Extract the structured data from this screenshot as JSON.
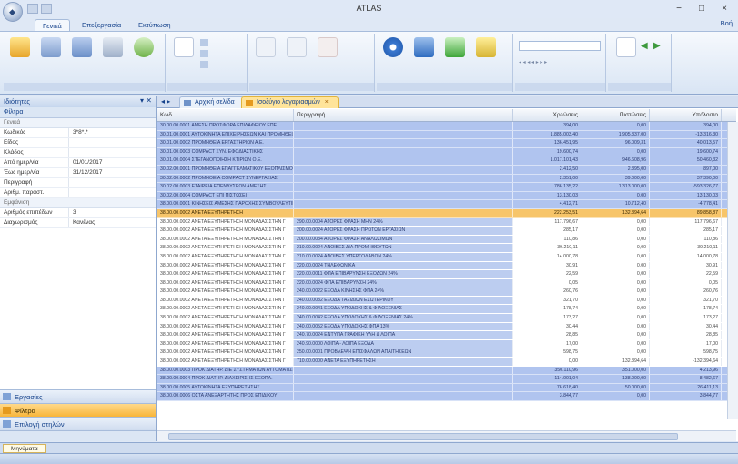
{
  "window": {
    "title": "ATLAS",
    "minimize": "−",
    "maximize": "□",
    "close": "×"
  },
  "ribbon_tabs": [
    "Γενικά",
    "Επεξεργασία",
    "Εκτύπωση"
  ],
  "ribbon_help": "Βοή",
  "left_panel": {
    "title": "Ιδιότητες",
    "subtitle": "Φίλτρα",
    "groups": [
      {
        "label": "Γενικά",
        "rows": [
          {
            "key": "Κωδικός",
            "value": "3*8*.*"
          },
          {
            "key": "Είδος",
            "value": ""
          },
          {
            "key": "Κλάδος",
            "value": ""
          },
          {
            "key": "Από ημερ/νία",
            "value": "01/01/2017"
          },
          {
            "key": "Έως ημερ/νία",
            "value": "31/12/2017"
          },
          {
            "key": "Περιγραφή",
            "value": ""
          },
          {
            "key": "Αριθμ. παραστ.",
            "value": ""
          }
        ]
      },
      {
        "label": "Εμφάνιση",
        "rows": [
          {
            "key": "Αριθμός επιπέδων",
            "value": "3"
          },
          {
            "key": "Διαχωρισμός",
            "value": "Κανένας"
          }
        ]
      }
    ],
    "nav": [
      {
        "label": "Εργασίες",
        "active": false
      },
      {
        "label": "Φίλτρα",
        "active": true
      },
      {
        "label": "Επιλογή στηλών",
        "active": false
      }
    ]
  },
  "doc_tabs": [
    {
      "label": "Αρχική σελίδα",
      "active": false
    },
    {
      "label": "Ισοζύγιο λογαριασμών",
      "active": true
    }
  ],
  "grid": {
    "columns": [
      "Κωδ.",
      "Περιγραφή",
      "Χρεώσεις",
      "Πιστώσεις",
      "Υπόλοιπο"
    ],
    "rows": [
      {
        "t": "blue",
        "code": "30.00.00.0001 ΑΜΕΣΗ ΠΡΟΣΦΟΡΑ ΕΠΙΔΑΦΕΙΟΥ ΕΠΕ",
        "desc": "",
        "a": "394,00",
        "b": "0,00",
        "c": "394,00"
      },
      {
        "t": "blue",
        "code": "30.01.00.0001 ΑΥΤΟΚΙΝΗΤΑ ΕΠΙΧΕΙΡΗΣΕΩΝ ΚΑΙ ΠΡΟΜΗΘΕΙΑ",
        "desc": "",
        "a": "1.885.003,40",
        "b": "1.905.337,00",
        "c": "-13.316,30"
      },
      {
        "t": "blue",
        "code": "30.01.00.0002 ΠΡΟΜΗΘΕΙΑ ΕΡΓΑΣΤΗΡΙΩΝ Α.Ε.",
        "desc": "",
        "a": "136.451,95",
        "b": "96.009,31",
        "c": "40.013,57"
      },
      {
        "t": "blue",
        "code": "30.01.00.0003 COMPACT ΣΥΝ. ΕΦΟΔΙΑΣΤΙΚΗΣ",
        "desc": "",
        "a": "19.600,74",
        "b": "0,00",
        "c": "19.600,74"
      },
      {
        "t": "blue",
        "code": "30.01.00.0004 ΣΤΕΓΑΝΟΠΟΙΗΣΗ ΚΤΙΡΙΩΝ Ο.Ε.",
        "desc": "",
        "a": "1.017.101,43",
        "b": "946.608,96",
        "c": "50.460,32"
      },
      {
        "t": "blue",
        "code": "30.02.00.0001 ΠΡΟΜΗΘΕΙΑ ΕΠΑΓΓΕΛΜΑΤΙΚΟΥ ΕΞΟΠΛΙΣΜΟΥ",
        "desc": "",
        "a": "2.412,50",
        "b": "2.395,00",
        "c": "897,00"
      },
      {
        "t": "blue",
        "code": "30.02.00.0002 ΠΡΟΜΗΘΕΙΑ COMPACT ΣΥΝΕΡΓΑΣΙΑΣ",
        "desc": "",
        "a": "2.351,00",
        "b": "39.000,00",
        "c": "37.390,00"
      },
      {
        "t": "blue",
        "code": "30.02.00.0003 ΕΤΑΙΡΕΙΑ ΕΠΕΝΔΥΣΕΩΝ ΑΜΕΣΗΣ",
        "desc": "",
        "a": "786.135,22",
        "b": "1.313.000,00",
        "c": "-593.326,77"
      },
      {
        "t": "blue",
        "code": "30.02.00.0004 COMPACT ΕΠΙ ΠΙΣΤΩΣΕΙ",
        "desc": "",
        "a": "13.130,03",
        "b": "0,00",
        "c": "13.130,03"
      },
      {
        "t": "blue",
        "code": "38.00.00.0001 ΚΙΝΗΣΕΙΣ ΑΜΕΣΗΣ ΠΑΡΟΧΗΣ ΣΥΜΒΟΥΛΕΥΤΙΚΗΣ",
        "desc": "",
        "a": "4.412,71",
        "b": "10.712,40",
        "c": "-4.778,41"
      },
      {
        "t": "selected",
        "code": "38.00.00.0002 ΑΝΕΤΑ ΕΞΥΠΗΡΕΤΗΣΗ",
        "desc": "",
        "a": "222.253,51",
        "b": "132.394,64",
        "c": "89.858,87"
      },
      {
        "t": "child",
        "code": "38.00.00.0002 ΑΝΕΤΑ ΕΞΥΠΗΡΕΤΗΣΗ ΜΟΝΑΔΑΣ ΣΤΗΝ Γ",
        "desc": "290.00.0004 ΑΓΟΡΕΣ ΦΡΑΣΗ ΜΗΝ 24%",
        "a": "117.796,67",
        "b": "0,00",
        "c": "117.796,67"
      },
      {
        "t": "child",
        "code": "38.00.00.0002 ΑΝΕΤΑ ΕΞΥΠΗΡΕΤΗΣΗ ΜΟΝΑΔΑΣ ΣΤΗΝ Γ",
        "desc": "200.00.0024 ΑΓΟΡΕΣ ΦΡΑΣΗ ΠΡΩΤΩΝ ΕΡΓΑΣΙΩΝ",
        "a": "285,17",
        "b": "0,00",
        "c": "285,17"
      },
      {
        "t": "child",
        "code": "38.00.00.0002 ΑΝΕΤΑ ΕΞΥΠΗΡΕΤΗΣΗ ΜΟΝΑΔΑΣ ΣΤΗΝ Γ",
        "desc": "200.00.0034 ΑΓΟΡΕΣ ΦΡΑΣΗ ΑΝΑΛΩΣΙΜΩΝ",
        "a": "110,86",
        "b": "0,00",
        "c": "110,86"
      },
      {
        "t": "child",
        "code": "38.00.00.0002 ΑΝΕΤΑ ΕΞΥΠΗΡΕΤΗΣΗ ΜΟΝΑΔΑΣ ΣΤΗΝ Γ",
        "desc": "210.00.0024 ΑΝΟΙΒΕΣ ΔΙΑ ΠΡΟΜΗΘΕΥΤΩΝ",
        "a": "39.210,11",
        "b": "0,00",
        "c": "39.210,11"
      },
      {
        "t": "child",
        "code": "38.00.00.0002 ΑΝΕΤΑ ΕΞΥΠΗΡΕΤΗΣΗ ΜΟΝΑΔΑΣ ΣΤΗΝ Γ",
        "desc": "210.00.0024 ΑΝΟΙΒΕΣ ΥΠΕΡΓΟΛΑΒΩΝ 24%",
        "a": "14.000,78",
        "b": "0,00",
        "c": "14.000,78"
      },
      {
        "t": "child",
        "code": "38.00.00.0002 ΑΝΕΤΑ ΕΞΥΠΗΡΕΤΗΣΗ ΜΟΝΑΔΑΣ ΣΤΗΝ Γ",
        "desc": "220.00.0024 ΤΗΛΕΦΩΝΙΚΑ",
        "a": "30,91",
        "b": "0,00",
        "c": "30,91"
      },
      {
        "t": "child",
        "code": "38.00.00.0002 ΑΝΕΤΑ ΕΞΥΠΗΡΕΤΗΣΗ ΜΟΝΑΔΑΣ ΣΤΗΝ Γ",
        "desc": "220.00.0011 ΦΠΑ ΕΠΙΒΑΡΥΝΣΗ ΕΞΟΔΩΝ 24%",
        "a": "22,59",
        "b": "0,00",
        "c": "22,59"
      },
      {
        "t": "child",
        "code": "38.00.00.0002 ΑΝΕΤΑ ΕΞΥΠΗΡΕΤΗΣΗ ΜΟΝΑΔΑΣ ΣΤΗΝ Γ",
        "desc": "220.00.0024 ΦΠΑ ΕΠΙΒΑΡΥΝΣΗ 24%",
        "a": "0,05",
        "b": "0,00",
        "c": "0,05"
      },
      {
        "t": "child",
        "code": "38.00.00.0002 ΑΝΕΤΑ ΕΞΥΠΗΡΕΤΗΣΗ ΜΟΝΑΔΑΣ ΣΤΗΝ Γ",
        "desc": "240.00.0022 ΕΞΟΔΑ ΚΙΝΗΣΗΣ ΦΠΑ 24%",
        "a": "260,76",
        "b": "0,00",
        "c": "260,76"
      },
      {
        "t": "child",
        "code": "38.00.00.0002 ΑΝΕΤΑ ΕΞΥΠΗΡΕΤΗΣΗ ΜΟΝΑΔΑΣ ΣΤΗΝ Γ",
        "desc": "240.00.0032 ΕΞΟΔΑ ΤΑΞΙΔΙΩΝ ΕΣΩΤΕΡΙΚΟΥ",
        "a": "321,70",
        "b": "0,00",
        "c": "321,70"
      },
      {
        "t": "child",
        "code": "38.00.00.0002 ΑΝΕΤΑ ΕΞΥΠΗΡΕΤΗΣΗ ΜΟΝΑΔΑΣ ΣΤΗΝ Γ",
        "desc": "240.00.0041 ΕΞΟΔΑ ΥΠΟΔΟΧΗΣ & ΦΙΛΟΞΕΝΙΑΣ",
        "a": "178,74",
        "b": "0,00",
        "c": "178,74"
      },
      {
        "t": "child",
        "code": "38.00.00.0002 ΑΝΕΤΑ ΕΞΥΠΗΡΕΤΗΣΗ ΜΟΝΑΔΑΣ ΣΤΗΝ Γ",
        "desc": "240.00.0042 ΕΞΟΔΑ ΥΠΟΔΟΧΗΣ & ΦΙΛΟΞΕΝΙΑΣ 24%",
        "a": "173,27",
        "b": "0,00",
        "c": "173,27"
      },
      {
        "t": "child",
        "code": "38.00.00.0002 ΑΝΕΤΑ ΕΞΥΠΗΡΕΤΗΣΗ ΜΟΝΑΔΑΣ ΣΤΗΝ Γ",
        "desc": "240.00.0052 ΕΞΟΔΑ ΥΠΟΔΟΧΗΣ ΦΠΑ 13%",
        "a": "30,44",
        "b": "0,00",
        "c": "30,44"
      },
      {
        "t": "child",
        "code": "38.00.00.0002 ΑΝΕΤΑ ΕΞΥΠΗΡΕΤΗΣΗ ΜΟΝΑΔΑΣ ΣΤΗΝ Γ",
        "desc": "240.70.0024 ΕΝΤΥΠΑ ΓΡΑΦΙΚΗ ΥΛΗ & ΛΟΙΠΑ",
        "a": "28,85",
        "b": "0,00",
        "c": "28,85"
      },
      {
        "t": "child",
        "code": "38.00.00.0002 ΑΝΕΤΑ ΕΞΥΠΗΡΕΤΗΣΗ ΜΟΝΑΔΑΣ ΣΤΗΝ Γ",
        "desc": "240.90.0000 ΛΟΙΠΑ - ΛΟΙΠΑ ΕΞΟΔΑ",
        "a": "17,00",
        "b": "0,00",
        "c": "17,00"
      },
      {
        "t": "child",
        "code": "38.00.00.0002 ΑΝΕΤΑ ΕΞΥΠΗΡΕΤΗΣΗ ΜΟΝΑΔΑΣ ΣΤΗΝ Γ",
        "desc": "250.00.0001 ΠΡΟΒΛΕΨΗ ΕΠΙΣΦΑΛΩΝ ΑΠΑΙΤΗΣΕΩΝ",
        "a": "598,75",
        "b": "0,00",
        "c": "598,75"
      },
      {
        "t": "child",
        "code": "38.00.00.0002 ΑΝΕΤΑ ΕΞΥΠΗΡΕΤΗΣΗ ΜΟΝΑΔΑΣ ΣΤΗΝ Γ",
        "desc": "710.00.0000 ΑΝΕΤΑ ΕΞΥΠΗΡΕΤΗΣΗ",
        "a": "0,00",
        "b": "132.394,64",
        "c": "-132.394,64"
      },
      {
        "t": "blue",
        "code": "38.00.00.0003 ΠΡΟΚ ΔΙΑΤΗΡ. ΔΙΕ ΣΥΣΤΗΜΑΤΩΝ ΑΥΤΟΜΑΤΙΣΜΟΥ",
        "desc": "",
        "a": "350.110,96",
        "b": "351.000,00",
        "c": "4.213,96"
      },
      {
        "t": "blue",
        "code": "38.00.00.0004 ΠΡΟΚ ΔΙΑΤΗΡ. ΔΙΑΧΕΙΡΙΣΗΣ ΕΞΟΠΛ.",
        "desc": "",
        "a": "114.001,04",
        "b": "138.000,00",
        "c": "-8.482,67"
      },
      {
        "t": "blue",
        "code": "38.00.00.0005 ΑΥΤΟΚΙΝΗΤΑ ΕΞΥΠΗΡΕΤΗΣΗΣ",
        "desc": "",
        "a": "76.618,40",
        "b": "50.000,00",
        "c": "26.411,13"
      },
      {
        "t": "blue",
        "code": "38.00.00.0006 ΟΣΤΑ ΑΝΕΞΑΡΤΗΤΗΣ ΠΡΟΣ ΕΠΙΔΙΚΟΥ",
        "desc": "",
        "a": "3.844,77",
        "b": "0,00",
        "c": "3.844,77"
      }
    ]
  },
  "footer_tab": "Μηνύματα",
  "status": [
    "",
    ""
  ]
}
